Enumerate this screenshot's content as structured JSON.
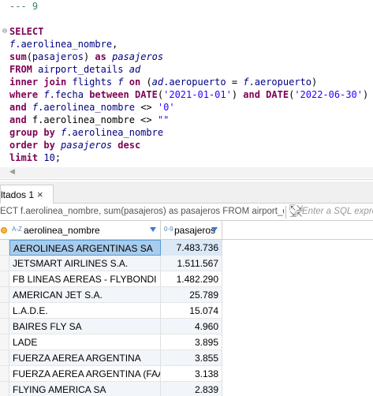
{
  "editor": {
    "lines": [
      [
        {
          "c": "c",
          "t": "--- 9"
        }
      ],
      [],
      [
        {
          "c": "k",
          "t": "SELECT"
        }
      ],
      [
        {
          "c": "i",
          "t": "f"
        },
        {
          "c": "b",
          "t": ".aerolinea_nombre"
        },
        {
          "c": "p",
          "t": ","
        }
      ],
      [
        {
          "c": "k",
          "t": "sum"
        },
        {
          "c": "p",
          "t": "("
        },
        {
          "c": "b",
          "t": "pasajeros"
        },
        {
          "c": "p",
          "t": ") "
        },
        {
          "c": "k",
          "t": "as"
        },
        {
          "c": "p",
          "t": " "
        },
        {
          "c": "i",
          "t": "pasajeros"
        }
      ],
      [
        {
          "c": "k",
          "t": "FROM"
        },
        {
          "c": "p",
          "t": " "
        },
        {
          "c": "b",
          "t": "airport_details"
        },
        {
          "c": "p",
          "t": " "
        },
        {
          "c": "i",
          "t": "ad"
        }
      ],
      [
        {
          "c": "k",
          "t": "inner join"
        },
        {
          "c": "p",
          "t": " "
        },
        {
          "c": "b",
          "t": "flights"
        },
        {
          "c": "p",
          "t": " "
        },
        {
          "c": "i",
          "t": "f"
        },
        {
          "c": "p",
          "t": " "
        },
        {
          "c": "k",
          "t": "on"
        },
        {
          "c": "p",
          "t": " ("
        },
        {
          "c": "i",
          "t": "ad"
        },
        {
          "c": "b",
          "t": ".aeropuerto"
        },
        {
          "c": "p",
          "t": " = "
        },
        {
          "c": "i",
          "t": "f"
        },
        {
          "c": "b",
          "t": ".aeropuerto"
        },
        {
          "c": "p",
          "t": ")"
        }
      ],
      [
        {
          "c": "k",
          "t": "where"
        },
        {
          "c": "p",
          "t": " "
        },
        {
          "c": "i",
          "t": "f"
        },
        {
          "c": "b",
          "t": ".fecha"
        },
        {
          "c": "p",
          "t": " "
        },
        {
          "c": "k",
          "t": "between DATE"
        },
        {
          "c": "p",
          "t": "("
        },
        {
          "c": "s",
          "t": "'2021-01-01'"
        },
        {
          "c": "p",
          "t": ") "
        },
        {
          "c": "k",
          "t": "and DATE"
        },
        {
          "c": "p",
          "t": "("
        },
        {
          "c": "s",
          "t": "'2022-06-30'"
        },
        {
          "c": "p",
          "t": ")"
        }
      ],
      [
        {
          "c": "k",
          "t": "and"
        },
        {
          "c": "p",
          "t": " "
        },
        {
          "c": "i",
          "t": "f"
        },
        {
          "c": "b",
          "t": ".aerolinea_nombre"
        },
        {
          "c": "p",
          "t": " <> "
        },
        {
          "c": "s",
          "t": "'0'"
        }
      ],
      [
        {
          "c": "k",
          "t": "and"
        },
        {
          "c": "p",
          "t": " f.aerolinea_nombre <> "
        },
        {
          "c": "s",
          "t": "\"\""
        }
      ],
      [
        {
          "c": "k",
          "t": "group by"
        },
        {
          "c": "p",
          "t": " "
        },
        {
          "c": "i",
          "t": "f"
        },
        {
          "c": "b",
          "t": ".aerolinea_nombre"
        }
      ],
      [
        {
          "c": "k",
          "t": "order by"
        },
        {
          "c": "p",
          "t": " "
        },
        {
          "c": "i",
          "t": "pasajeros"
        },
        {
          "c": "p",
          "t": " "
        },
        {
          "c": "k",
          "t": "desc"
        }
      ],
      [
        {
          "c": "k",
          "t": "limit"
        },
        {
          "c": "p",
          "t": " "
        },
        {
          "c": "b",
          "t": "10"
        },
        {
          "c": "p",
          "t": ";"
        }
      ]
    ],
    "collapse_line": 2
  },
  "results": {
    "tab_label": "ltados 1",
    "tab_close": "×",
    "query_preview": "ECT f.aerolinea_nombre, sum(pasajeros) as pasajeros FROM airport_de",
    "filter_icon": "expand-icon",
    "filter_placeholder": "Enter a SQL expre"
  },
  "grid": {
    "columns": [
      {
        "label": "aerolinea_nombre",
        "type_glyph": "A-Z",
        "type": "text"
      },
      {
        "label": "pasajeros",
        "type_glyph": "0-9",
        "type": "number"
      }
    ],
    "rows": [
      [
        "AEROLINEAS ARGENTINAS SA",
        "7.483.736"
      ],
      [
        "JETSMART AIRLINES S.A.",
        "1.511.567"
      ],
      [
        "FB LINEAS AEREAS - FLYBONDI",
        "1.482.290"
      ],
      [
        "AMERICAN JET S.A.",
        "25.789"
      ],
      [
        "L.A.D.E.",
        "15.074"
      ],
      [
        "BAIRES FLY SA",
        "4.960"
      ],
      [
        "LADE",
        "3.895"
      ],
      [
        "FUERZA AEREA ARGENTINA",
        "3.855"
      ],
      [
        "FUERZA AEREA ARGENTINA (FAA)",
        "3.138"
      ],
      [
        "FLYING AMERICA SA",
        "2.839"
      ]
    ],
    "selected_row": 0
  },
  "colors": {
    "keyword": "#7f0055",
    "identifier": "#000080",
    "string": "#2a00ff",
    "comment": "#3f7f5f",
    "selection": "#a8ccec",
    "sort_arrow": "#3b78d8"
  }
}
